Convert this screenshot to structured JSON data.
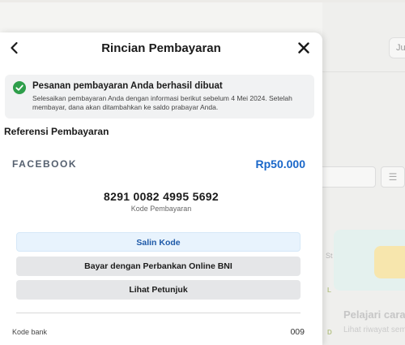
{
  "background": {
    "chip_text": "Ju",
    "card_section_label": "St",
    "list_tag_1": "L",
    "list_tag_2": "D",
    "learn_title": "Pelajari cara m",
    "learn_subtitle": "Lihat riwayat semu"
  },
  "modal": {
    "title": "Rincian Pembayaran",
    "back_icon": "chevron-left-icon",
    "close_icon": "close-icon",
    "alert": {
      "icon": "check-circle-icon",
      "title": "Pesanan pembayaran Anda berhasil dibuat",
      "description": "Selesaikan pembayaran Anda dengan informasi berikut sebelum 4 Mei 2024. Setelah membayar, dana akan ditambahkan ke saldo prabayar Anda."
    },
    "section_title": "Referensi Pembayaran",
    "merchant": "FACEBOOK",
    "amount": "Rp50.000",
    "payment_code": "8291 0082 4995 5692",
    "payment_code_label": "Kode Pembayaran",
    "buttons": {
      "copy": "Salin Kode",
      "bank": "Bayar dengan Perbankan Online BNI",
      "guide": "Lihat Petunjuk"
    },
    "details": [
      {
        "label": "Kode bank",
        "value": "009"
      }
    ]
  },
  "colors": {
    "accent": "#1a67c9",
    "success": "#2e9e4a",
    "copy_button_bg": "#e8f3fd",
    "secondary_button_bg": "#e5e6e8"
  }
}
